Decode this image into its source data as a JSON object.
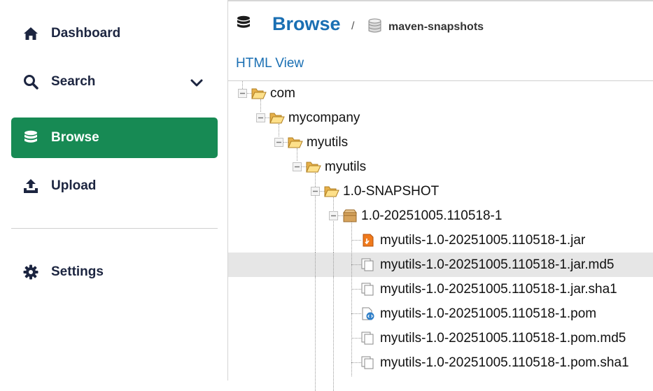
{
  "sidebar": {
    "items": [
      {
        "label": "Dashboard",
        "icon": "home-icon"
      },
      {
        "label": "Search",
        "icon": "search-icon"
      },
      {
        "label": "Browse",
        "icon": "database-icon",
        "active": true
      },
      {
        "label": "Upload",
        "icon": "upload-icon"
      },
      {
        "label": "Settings",
        "icon": "gear-icon"
      }
    ]
  },
  "header": {
    "title": "Browse",
    "separator": "/",
    "repository": "maven-snapshots"
  },
  "html_view_link": "HTML View",
  "tree": {
    "nodes": [
      {
        "label": "com",
        "type": "folder",
        "expanded": true
      },
      {
        "label": "mycompany",
        "type": "folder",
        "expanded": true
      },
      {
        "label": "myutils",
        "type": "folder",
        "expanded": true
      },
      {
        "label": "myutils",
        "type": "folder",
        "expanded": true
      },
      {
        "label": "1.0-SNAPSHOT",
        "type": "folder",
        "expanded": true
      },
      {
        "label": "1.0-20251005.110518-1",
        "type": "component",
        "expanded": true
      },
      {
        "label": "myutils-1.0-20251005.110518-1.jar",
        "type": "jar-file"
      },
      {
        "label": "myutils-1.0-20251005.110518-1.jar.md5",
        "type": "file",
        "selected": true
      },
      {
        "label": "myutils-1.0-20251005.110518-1.jar.sha1",
        "type": "file"
      },
      {
        "label": "myutils-1.0-20251005.110518-1.pom",
        "type": "pom-file"
      },
      {
        "label": "myutils-1.0-20251005.110518-1.pom.md5",
        "type": "file"
      },
      {
        "label": "myutils-1.0-20251005.110518-1.pom.sha1",
        "type": "file"
      }
    ]
  },
  "colors": {
    "accent": "#178a54",
    "link": "#1a6fb3",
    "nav_text": "#1c2540",
    "selected_row": "#e6e6e6"
  }
}
